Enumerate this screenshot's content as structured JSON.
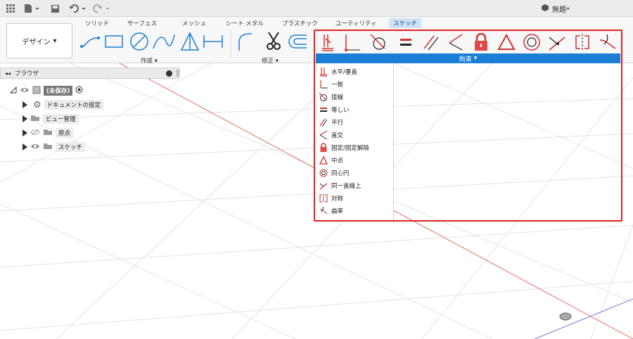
{
  "app": {
    "document_title": "無題*"
  },
  "tabs": [
    {
      "label": "ソリッド",
      "active": false
    },
    {
      "label": "サーフェス",
      "active": false
    },
    {
      "label": "メッシュ",
      "active": false
    },
    {
      "label": "シート メタル",
      "active": false
    },
    {
      "label": "プラスチック",
      "active": false
    },
    {
      "label": "ユーティリティ",
      "active": false
    },
    {
      "label": "スケッチ",
      "active": true
    }
  ],
  "ribbon": {
    "design_label": "デザイン",
    "create_label": "作成",
    "modify_label": "修正",
    "constraints_label": "拘束"
  },
  "constraints_menu": [
    {
      "label": "水平/垂直",
      "icon": "horizontal-vertical-icon"
    },
    {
      "label": "一致",
      "icon": "coincident-icon"
    },
    {
      "label": "接線",
      "icon": "tangent-icon"
    },
    {
      "label": "等しい",
      "icon": "equal-icon"
    },
    {
      "label": "平行",
      "icon": "parallel-icon"
    },
    {
      "label": "直交",
      "icon": "perpendicular-icon"
    },
    {
      "label": "固定/固定解除",
      "icon": "fix-unfix-icon"
    },
    {
      "label": "中点",
      "icon": "midpoint-icon"
    },
    {
      "label": "同心円",
      "icon": "concentric-icon"
    },
    {
      "label": "同一直線上",
      "icon": "collinear-icon"
    },
    {
      "label": "対称",
      "icon": "symmetry-icon"
    },
    {
      "label": "曲率",
      "icon": "curvature-icon"
    }
  ],
  "browser": {
    "title": "ブラウザ",
    "root_label": "(未保存)",
    "items": [
      {
        "label": "ドキュメントの設定",
        "icon": "gear-icon"
      },
      {
        "label": "ビュー管理",
        "icon": "folder-icon"
      },
      {
        "label": "原点",
        "icon": "folder-icon"
      },
      {
        "label": "スケッチ",
        "icon": "folder-icon"
      }
    ]
  },
  "colors": {
    "accent_blue": "#1a7fd4",
    "highlight_red": "#e02020",
    "constraint_red": "#d0312d",
    "tab_active_bg": "#cfe3f6"
  }
}
